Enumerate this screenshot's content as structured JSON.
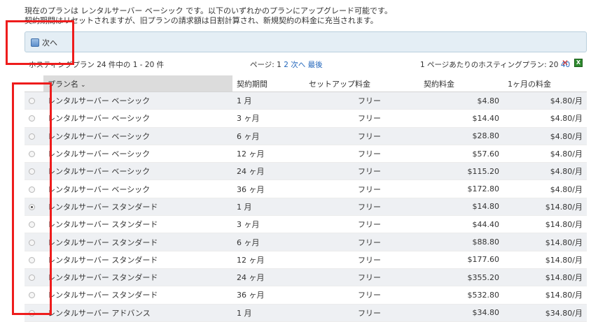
{
  "intro": {
    "line1": "現在のプランは レンタルサーバー ベーシック です。以下のいずれかのプランにアップグレード可能です。",
    "line2": "契約期間はリセットされますが、旧プランの請求額は日割計算され、新規契約の料金に充当されます。"
  },
  "toolbar": {
    "next_label": "次へ",
    "next_icon": "page-icon"
  },
  "info": {
    "count_text": "ホスティングプラン 24 件中の 1 - 20 件",
    "page_label": "ページ: ",
    "page_current": "1",
    "page_2": "2",
    "next_link": "次へ",
    "last_link": "最後",
    "perpage_text": "1 ページあたりのホスティングプラン: 20 ",
    "perpage_alt": "40",
    "tool_icons": [
      "settings-icon",
      "excel-export-icon"
    ]
  },
  "table": {
    "columns": [
      "",
      "プラン名",
      "契約期間",
      "セットアップ料金",
      "",
      "契約料金",
      "1ヶ月の料金"
    ],
    "sorted_column": "プラン名",
    "rows": [
      {
        "selected": false,
        "name": "レンタルサーバー ベーシック",
        "term": "1 月",
        "setup": "フリー",
        "price": "$4.80",
        "monthly": "$4.80/月"
      },
      {
        "selected": false,
        "name": "レンタルサーバー ベーシック",
        "term": "3 ヶ月",
        "setup": "フリー",
        "price": "$14.40",
        "monthly": "$4.80/月"
      },
      {
        "selected": false,
        "name": "レンタルサーバー ベーシック",
        "term": "6 ヶ月",
        "setup": "フリー",
        "price": "$28.80",
        "monthly": "$4.80/月"
      },
      {
        "selected": false,
        "name": "レンタルサーバー ベーシック",
        "term": "12 ヶ月",
        "setup": "フリー",
        "price": "$57.60",
        "monthly": "$4.80/月"
      },
      {
        "selected": false,
        "name": "レンタルサーバー ベーシック",
        "term": "24 ヶ月",
        "setup": "フリー",
        "price": "$115.20",
        "monthly": "$4.80/月"
      },
      {
        "selected": false,
        "name": "レンタルサーバー ベーシック",
        "term": "36 ヶ月",
        "setup": "フリー",
        "price": "$172.80",
        "monthly": "$4.80/月"
      },
      {
        "selected": true,
        "name": "レンタルサーバー スタンダード",
        "term": "1 月",
        "setup": "フリー",
        "price": "$14.80",
        "monthly": "$14.80/月"
      },
      {
        "selected": false,
        "name": "レンタルサーバー スタンダード",
        "term": "3 ヶ月",
        "setup": "フリー",
        "price": "$44.40",
        "monthly": "$14.80/月"
      },
      {
        "selected": false,
        "name": "レンタルサーバー スタンダード",
        "term": "6 ヶ月",
        "setup": "フリー",
        "price": "$88.80",
        "monthly": "$14.80/月"
      },
      {
        "selected": false,
        "name": "レンタルサーバー スタンダード",
        "term": "12 ヶ月",
        "setup": "フリー",
        "price": "$177.60",
        "monthly": "$14.80/月"
      },
      {
        "selected": false,
        "name": "レンタルサーバー スタンダード",
        "term": "24 ヶ月",
        "setup": "フリー",
        "price": "$355.20",
        "monthly": "$14.80/月"
      },
      {
        "selected": false,
        "name": "レンタルサーバー スタンダード",
        "term": "36 ヶ月",
        "setup": "フリー",
        "price": "$532.80",
        "monthly": "$14.80/月"
      },
      {
        "selected": false,
        "name": "レンタルサーバー アドバンス",
        "term": "1 月",
        "setup": "フリー",
        "price": "$34.80",
        "monthly": "$34.80/月"
      }
    ]
  },
  "colors": {
    "highlight_box": "#ee1c1c",
    "link": "#2266bb",
    "toolbar_bg": "#e4eef5"
  }
}
